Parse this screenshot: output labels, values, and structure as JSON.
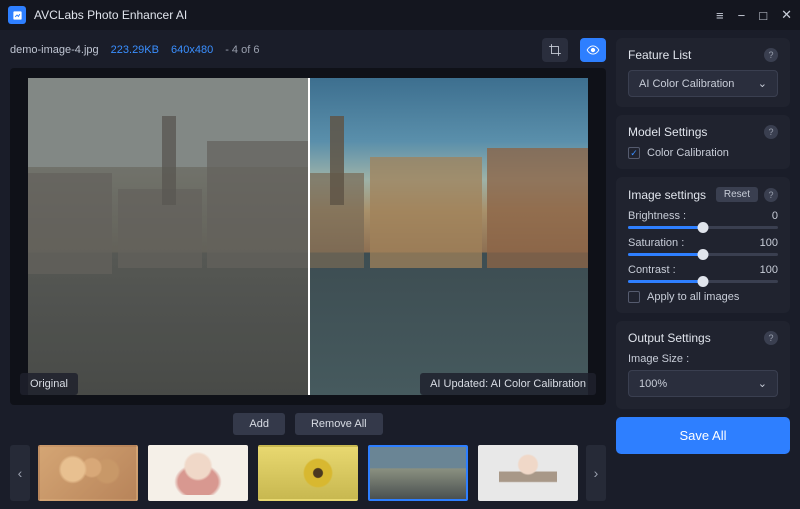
{
  "titlebar": {
    "app_name": "AVCLabs Photo Enhancer AI"
  },
  "info": {
    "filename": "demo-image-4.jpg",
    "filesize": "223.29KB",
    "dimensions": "640x480",
    "position": "- 4 of 6"
  },
  "preview": {
    "original_label": "Original",
    "ai_label": "AI Updated: AI Color Calibration"
  },
  "toolbar": {
    "add": "Add",
    "remove_all": "Remove All"
  },
  "feature": {
    "title": "Feature List",
    "selected": "AI Color Calibration"
  },
  "model": {
    "title": "Model Settings",
    "item": "Color Calibration",
    "checked": true
  },
  "image_settings": {
    "title": "Image settings",
    "reset": "Reset",
    "sliders": [
      {
        "label": "Brightness :",
        "value": 0,
        "min": -100,
        "max": 100
      },
      {
        "label": "Saturation :",
        "value": 100,
        "min": 0,
        "max": 200
      },
      {
        "label": "Contrast :",
        "value": 100,
        "min": 0,
        "max": 200
      }
    ],
    "apply_all": "Apply to all images",
    "apply_all_checked": false
  },
  "output": {
    "title": "Output Settings",
    "size_label": "Image Size :",
    "size_value": "100%"
  },
  "save_all": "Save All",
  "thumbs": {
    "selected_index": 3
  }
}
